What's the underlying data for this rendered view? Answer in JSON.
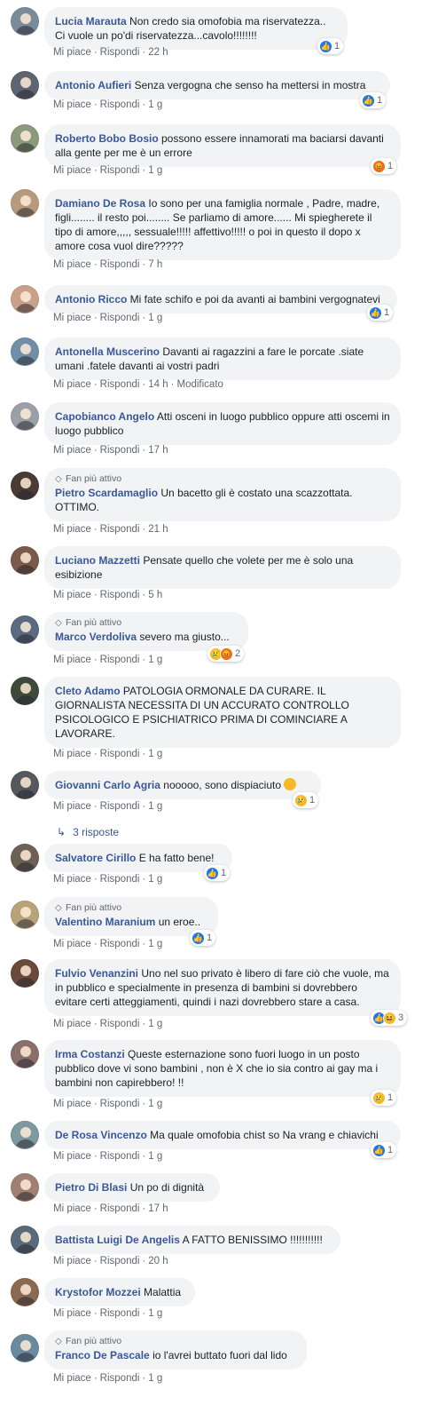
{
  "ui": {
    "like_label": "Mi piace",
    "reply_label": "Rispondi",
    "sep": "·",
    "top_fan_label": "Fan più attivo",
    "edited_label": "Modificato"
  },
  "comments": [
    {
      "author": "Lucia Marauta",
      "text": "Non credo sia omofobia ma riservatezza.. Ci vuole un po'di riservatezza...cavolo!!!!!!!!",
      "time": "22 h",
      "reaction": {
        "icons": [
          "like"
        ],
        "count": "1"
      },
      "avatar_color": "#7a8b99"
    },
    {
      "author": "Antonio Aufieri",
      "text": "Senza vergogna che senso ha mettersi in mostra",
      "time": "1 g",
      "reaction": {
        "icons": [
          "like"
        ],
        "count": "1"
      },
      "avatar_color": "#5d6570"
    },
    {
      "author": "Roberto Bobo Bosio",
      "text": "possono essere innamorati ma baciarsi davanti alla gente per me è un errore",
      "time": "1 g",
      "reaction": {
        "icons": [
          "angry"
        ],
        "count": "1"
      },
      "avatar_color": "#8a9a7a"
    },
    {
      "author": "Damiano De Rosa",
      "text": "Io sono per una famiglia normale , Padre, madre, figli........ il resto poi........ Se parliamo di amore...... Mi spiegherete il tipo di amore,,,,, sessuale!!!!! affettivo!!!!! o poi in questo il dopo x amore cosa vuol dire?????",
      "time": "7 h",
      "avatar_color": "#b59a7c"
    },
    {
      "author": "Antonio Ricco",
      "text": "Mi fate schifo e poi da avanti ai bambini vergognatevi",
      "time": "1 g",
      "reaction": {
        "icons": [
          "like"
        ],
        "count": "1"
      },
      "avatar_color": "#c9a08a"
    },
    {
      "author": "Antonella Muscerino",
      "text": "Davanti ai ragazzini a fare le porcate .siate umani .fatele davanti ai vostri padri",
      "time": "14 h",
      "edited": true,
      "avatar_color": "#6f8fa8"
    },
    {
      "author": "Capobianco Angelo",
      "text": "Atti osceni in luogo pubblico oppure atti oscemi in luogo pubblico",
      "time": "17 h",
      "avatar_color": "#9aa0a6"
    },
    {
      "author": "Pietro Scardamaglio",
      "text": "Un bacetto gli è costato una scazzottata. OTTIMO.",
      "time": "21 h",
      "top_fan": true,
      "avatar_color": "#4a3b35"
    },
    {
      "author": "Luciano Mazzetti",
      "text": "Pensate quello che volete per me è solo una esibizione",
      "time": "5 h",
      "avatar_color": "#7a5a4a"
    },
    {
      "author": "Marco Verdoliva",
      "text": "severo ma giusto...",
      "time": "1 g",
      "top_fan": true,
      "reaction": {
        "icons": [
          "sad",
          "angry"
        ],
        "count": "2"
      },
      "avatar_color": "#5a6a80"
    },
    {
      "author": "Cleto Adamo",
      "text": "PATOLOGIA ORMONALE DA CURARE. IL GIORNALISTA NECESSITA DI UN ACCURATO CONTROLLO PSICOLOGICO E PSICHIATRICO PRIMA DI COMINCIARE A LAVORARE.",
      "time": "1 g",
      "avatar_color": "#3e4a3a"
    },
    {
      "author": "Giovanni Carlo Agria",
      "text": "nooooo, sono dispiaciuto",
      "time": "1 g",
      "emoji": true,
      "reaction": {
        "icons": [
          "sad"
        ],
        "count": "1"
      },
      "replies": "3 risposte",
      "avatar_color": "#55585c"
    },
    {
      "author": "Salvatore Cirillo",
      "text": "E ha fatto bene!",
      "time": "1 g",
      "reaction": {
        "icons": [
          "like"
        ],
        "count": "1"
      },
      "avatar_color": "#6b6155"
    },
    {
      "author": "Valentino Maranium",
      "text": "un eroe..",
      "time": "1 g",
      "top_fan": true,
      "reaction": {
        "icons": [
          "like"
        ],
        "count": "1"
      },
      "avatar_color": "#b8a27a"
    },
    {
      "author": "Fulvio Venanzini",
      "text": "Uno nel suo privato è libero di fare ciò che vuole, ma in pubblico e specialmente in presenza di bambini si dovrebbero evitare certi atteggiamenti, quindi i nazi dovrebbero stare a casa.",
      "time": "1 g",
      "reaction": {
        "icons": [
          "like",
          "haha"
        ],
        "count": "3"
      },
      "avatar_color": "#6a4a3a"
    },
    {
      "author": "Irma Costanzi",
      "text": "Queste esternazione sono fuori luogo in un posto pubblico dove vi sono bambini , non è X che io sia contro ai gay ma i bambini non capirebbero! !!",
      "time": "1 g",
      "reaction": {
        "icons": [
          "sad"
        ],
        "count": "1"
      },
      "avatar_color": "#8b6f6a"
    },
    {
      "author": "De Rosa Vincenzo",
      "text": "Ma quale omofobia chist so Na vrang e chiavichi",
      "time": "1 g",
      "reaction": {
        "icons": [
          "like"
        ],
        "count": "1"
      },
      "avatar_color": "#7e9aa0"
    },
    {
      "author": "Pietro Di Blasi",
      "text": "Un po di dignità",
      "time": "17 h",
      "avatar_color": "#a08070"
    },
    {
      "author": "Battista Luigi De Angelis",
      "text": "A FATTO BENISSIMO !!!!!!!!!!!",
      "time": "20 h",
      "avatar_color": "#5a6a7a"
    },
    {
      "author": "Krystofor Mozzei",
      "text": "Malattia",
      "time": "1 g",
      "avatar_color": "#8a6a50"
    },
    {
      "author": "Franco De Pascale",
      "text": "io l'avrei buttato fuori dal lido",
      "time": "1 g",
      "top_fan": true,
      "avatar_color": "#6a8aa0"
    }
  ]
}
